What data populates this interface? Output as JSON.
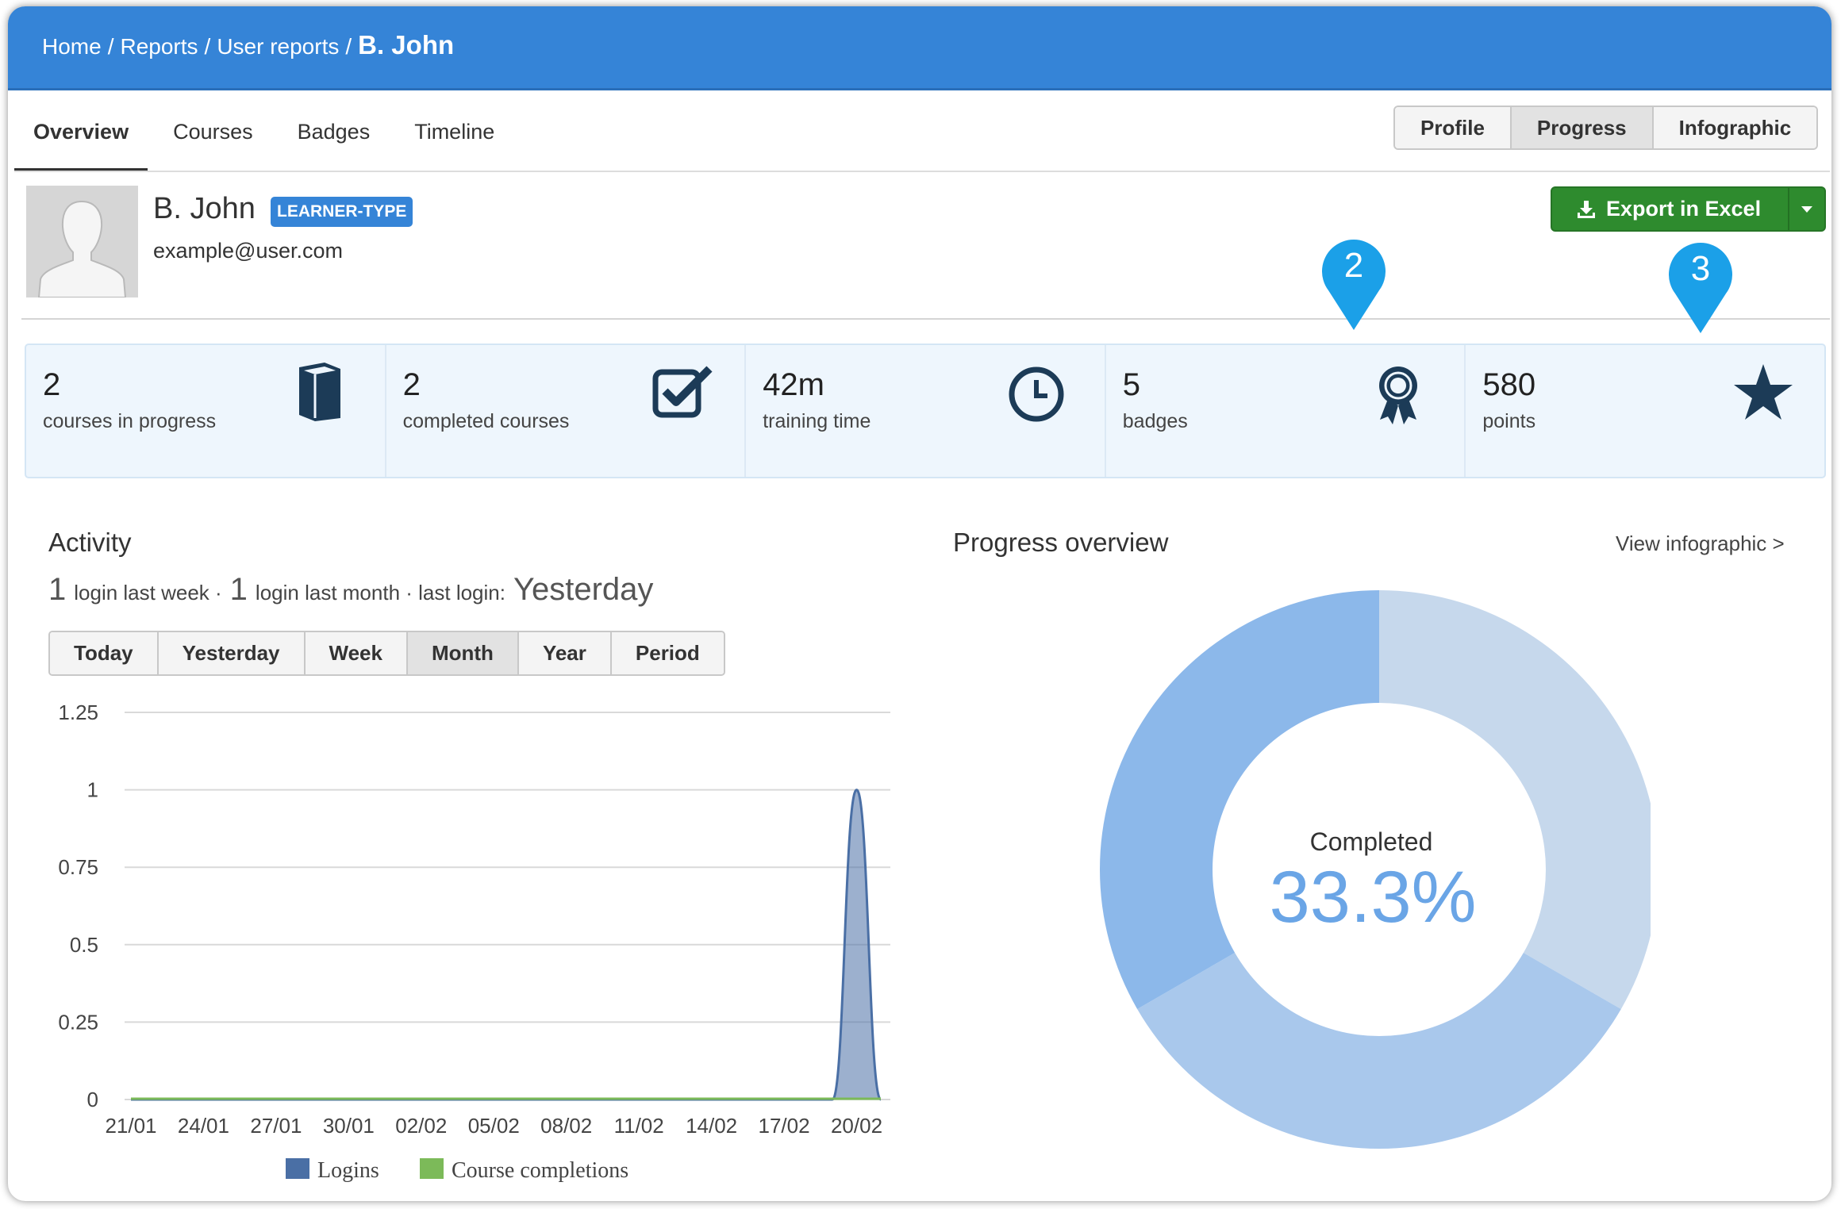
{
  "breadcrumb": {
    "items": [
      "Home",
      "Reports",
      "User reports"
    ],
    "current": "B. John"
  },
  "tabs": [
    "Overview",
    "Courses",
    "Badges",
    "Timeline"
  ],
  "active_tab": "Overview",
  "view_switch": {
    "options": [
      "Profile",
      "Progress",
      "Infographic"
    ],
    "active": "Progress"
  },
  "user": {
    "name": "B. John",
    "type_badge": "LEARNER-TYPE",
    "email": "example@user.com"
  },
  "export": {
    "label": "Export in Excel"
  },
  "markers": [
    "2",
    "3"
  ],
  "stats": [
    {
      "value": "2",
      "label": "courses in progress",
      "icon": "book-icon"
    },
    {
      "value": "2",
      "label": "completed courses",
      "icon": "checkbox-icon"
    },
    {
      "value": "42m",
      "label": "training time",
      "icon": "clock-icon"
    },
    {
      "value": "5",
      "label": "badges",
      "icon": "ribbon-icon"
    },
    {
      "value": "580",
      "label": "points",
      "icon": "star-icon"
    }
  ],
  "activity": {
    "title": "Activity",
    "summary": {
      "week_count": "1",
      "week_text": "login last week ·",
      "month_count": "1",
      "month_text": "login last month · last login:",
      "last_login": "Yesterday"
    },
    "periods": [
      "Today",
      "Yesterday",
      "Week",
      "Month",
      "Year",
      "Period"
    ],
    "active_period": "Month"
  },
  "progress": {
    "title": "Progress overview",
    "link": "View infographic >",
    "center_label": "Completed",
    "center_value": "33.3%"
  },
  "colors": {
    "header": "#3584d7",
    "export": "#2e8b2e",
    "logins": "#4a6fa5",
    "completions": "#7cba59",
    "donut_completed": "#8cb8ea",
    "donut_in_progress": "#a9c8ec",
    "donut_not_started": "#c6d8ec",
    "marker": "#1ba0e8"
  },
  "chart_data": [
    {
      "type": "area",
      "x": [
        "21/01",
        "22/01",
        "23/01",
        "24/01",
        "25/01",
        "26/01",
        "27/01",
        "28/01",
        "29/01",
        "30/01",
        "31/01",
        "01/02",
        "02/02",
        "03/02",
        "04/02",
        "05/02",
        "06/02",
        "07/02",
        "08/02",
        "09/02",
        "10/02",
        "11/02",
        "12/02",
        "13/02",
        "14/02",
        "15/02",
        "16/02",
        "17/02",
        "18/02",
        "19/02",
        "20/02",
        "21/02"
      ],
      "x_ticks": [
        "21/01",
        "24/01",
        "27/01",
        "30/01",
        "02/02",
        "05/02",
        "08/02",
        "11/02",
        "14/02",
        "17/02",
        "20/02"
      ],
      "y_ticks": [
        "1.25",
        "1",
        "0.75",
        "0.5",
        "0.25",
        "0"
      ],
      "ylim": [
        0,
        1.25
      ],
      "series": [
        {
          "name": "Logins",
          "values": [
            0,
            0,
            0,
            0,
            0,
            0,
            0,
            0,
            0,
            0,
            0,
            0,
            0,
            0,
            0,
            0,
            0,
            0,
            0,
            0,
            0,
            0,
            0,
            0,
            0,
            0,
            0,
            0,
            0,
            0,
            1,
            0
          ]
        },
        {
          "name": "Course completions",
          "values": [
            0,
            0,
            0,
            0,
            0,
            0,
            0,
            0,
            0,
            0,
            0,
            0,
            0,
            0,
            0,
            0,
            0,
            0,
            0,
            0,
            0,
            0,
            0,
            0,
            0,
            0,
            0,
            0,
            0,
            0,
            0,
            0
          ]
        }
      ],
      "legend": "bottom"
    },
    {
      "type": "pie",
      "labels": [
        "",
        "",
        ""
      ],
      "values": [
        33.3,
        33.3,
        33.3
      ],
      "hole": true
    }
  ]
}
